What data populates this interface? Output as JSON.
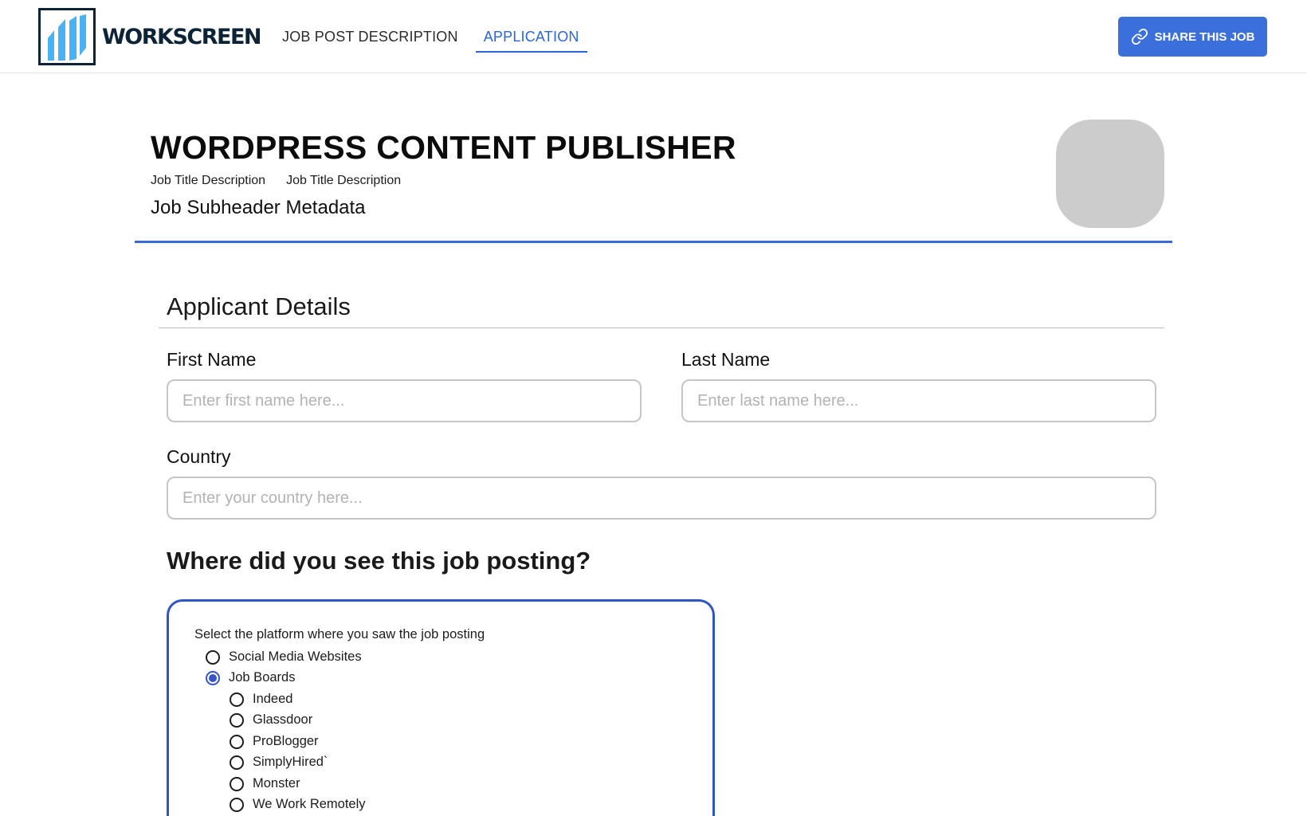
{
  "brand": {
    "name": "WORKSCREEN",
    "logo_icon": "workscreen-logo-icon",
    "colors": {
      "navy": "#0d2436",
      "sky": "#4ab1f2"
    }
  },
  "nav": {
    "items": [
      {
        "label": "JOB POST DESCRIPTION",
        "active": false
      },
      {
        "label": "APPLICATION",
        "active": true
      }
    ]
  },
  "share": {
    "label": "SHARE THIS JOB",
    "icon": "link-icon"
  },
  "job": {
    "title": "WORDPRESS CONTENT PUBLISHER",
    "meta": [
      "Job Title Description",
      "Job Title Description"
    ],
    "subheader": "Job Subheader Metadata"
  },
  "form": {
    "section_title": "Applicant Details",
    "first_name": {
      "label": "First Name",
      "placeholder": "Enter first name here...",
      "value": ""
    },
    "last_name": {
      "label": "Last Name",
      "placeholder": "Enter last name here...",
      "value": ""
    },
    "country": {
      "label": "Country",
      "placeholder": "Enter your country here...",
      "value": ""
    },
    "source_question": "Where did you see this job posting?",
    "platform_prompt": "Select the platform where you saw the job posting",
    "options": [
      {
        "label": "Social Media Websites",
        "checked": false
      },
      {
        "label": "Job Boards",
        "checked": true
      }
    ],
    "suboptions": [
      {
        "label": "Indeed",
        "checked": false
      },
      {
        "label": "Glassdoor",
        "checked": false
      },
      {
        "label": "ProBlogger",
        "checked": false
      },
      {
        "label": "SimplyHired`",
        "checked": false
      },
      {
        "label": "Monster",
        "checked": false
      },
      {
        "label": "We Work Remotely",
        "checked": false
      }
    ]
  },
  "accent_colors": {
    "primary": "#3a6fdc",
    "radio_selected": "#3556c4"
  }
}
